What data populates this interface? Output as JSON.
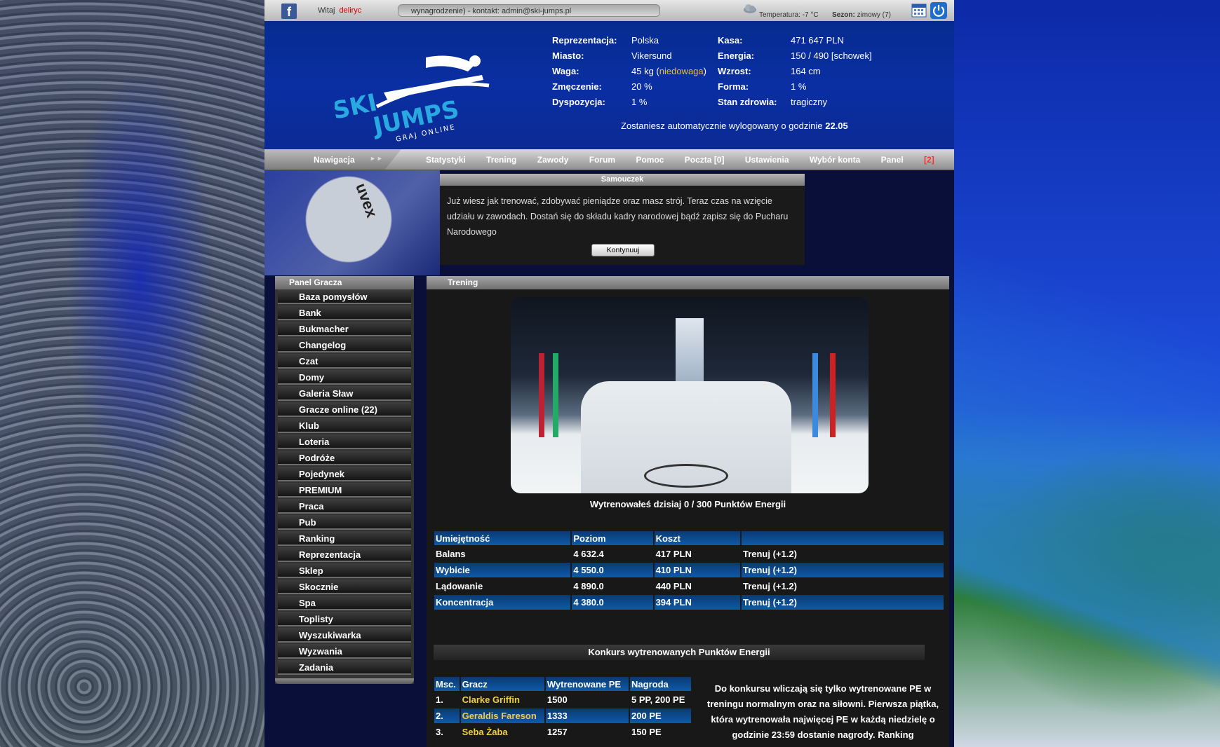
{
  "topbar": {
    "welcome_label": "Witaj",
    "username": "deliryc",
    "ticker": "wynagrodzenie) - kontakt: admin@ski-jumps.pl",
    "temperature": "Temperatura: -7 °C",
    "season_label": "Sezon:",
    "season_value": "zimowy (7)"
  },
  "logo": {
    "line1": "SKI",
    "line2": "JUMPS",
    "tagline": "GRAJ ONLINE"
  },
  "stats": {
    "representation_label": "Reprezentacja:",
    "representation": "Polska",
    "city_label": "Miasto:",
    "city": "Vikersund",
    "weight_label": "Waga:",
    "weight": "45 kg (",
    "weight_note": "niedowaga",
    "weight_close": ")",
    "fatigue_label": "Zmęczenie:",
    "fatigue": "20 %",
    "disposition_label": "Dyspozycja:",
    "disposition": "1 %",
    "cash_label": "Kasa:",
    "cash": "471 647 PLN",
    "energy_label": "Energia:",
    "energy": "150 / 490 [schowek]",
    "height_label": "Wzrost:",
    "height": "164 cm",
    "form_label": "Forma:",
    "form": "1 %",
    "health_label": "Stan zdrowia:",
    "health": "tragiczny",
    "logout_note": "Zostaniesz automatycznie wylogowany o godzinie",
    "logout_time": "22.05"
  },
  "nav": {
    "label": "Nawigacja",
    "arrows": "►►",
    "items": [
      "Statystyki",
      "Trening",
      "Zawody",
      "Forum",
      "Pomoc",
      "Poczta [0]",
      "Ustawienia",
      "Wybór konta"
    ],
    "panel_label": "Panel",
    "panel_badge": "[2]"
  },
  "banner": {
    "brand": "uvex"
  },
  "tutorial": {
    "title": "Samouczek",
    "text": "Już wiesz jak trenować, zdobywać pieniądze oraz masz strój. Teraz czas na wzięcie udziału w zawodach. Dostań się do składu kadry narodowej bądź zapisz się do Pucharu Narodowego",
    "button": "Kontynuuj"
  },
  "player_panel": {
    "title": "Panel Gracza",
    "items": [
      "Baza pomysłów",
      "Bank",
      "Bukmacher",
      "Changelog",
      "Czat",
      "Domy",
      "Galeria Sław",
      "Gracze online (22)",
      "Klub",
      "Loteria",
      "Podróże",
      "Pojedynek",
      "PREMIUM",
      "Praca",
      "Pub",
      "Ranking",
      "Reprezentacja",
      "Sklep",
      "Skocznie",
      "Spa",
      "Toplisty",
      "Wyszukiwarka",
      "Wyzwania",
      "Zadania"
    ]
  },
  "training": {
    "title": "Trening",
    "daily": "Wytrenowałeś dzisiaj 0 / 300 Punktów Energii",
    "headers": [
      "Umiejętność",
      "Poziom",
      "Koszt",
      ""
    ],
    "rows": [
      {
        "skill": "Balans",
        "level": "4 632.4",
        "cost": "417 PLN",
        "action": "Trenuj (+1.2)"
      },
      {
        "skill": "Wybicie",
        "level": "4 550.0",
        "cost": "410 PLN",
        "action": "Trenuj (+1.2)"
      },
      {
        "skill": "Lądowanie",
        "level": "4 890.0",
        "cost": "440 PLN",
        "action": "Trenuj (+1.2)"
      },
      {
        "skill": "Koncentracja",
        "level": "4 380.0",
        "cost": "394 PLN",
        "action": "Trenuj (+1.2)"
      }
    ]
  },
  "contest": {
    "title": "Konkurs wytrenowanych Punktów Energii",
    "headers": [
      "Msc.",
      "Gracz",
      "Wytrenowane PE",
      "Nagroda"
    ],
    "rows": [
      {
        "place": "1.",
        "player": "Clarke Griffin",
        "pe": "1500",
        "prize": "5 PP, 200 PE"
      },
      {
        "place": "2.",
        "player": "Geraldis Fareson",
        "pe": "1333",
        "prize": "200 PE"
      },
      {
        "place": "3.",
        "player": "Seba Żaba",
        "pe": "1257",
        "prize": "150 PE"
      }
    ],
    "note": "Do konkursu wliczają się tylko wytrenowane PE w treningu normalnym oraz na siłowni. Pierwsza piątka, która wytrenowała najwięcej PE w każdą niedzielę o godzinie 23:59 dostanie nagrody. Ranking"
  },
  "colors": {
    "accent_yellow": "#f0d040",
    "badge_red": "#ff3030",
    "table_blue": "#0e5aa8"
  }
}
